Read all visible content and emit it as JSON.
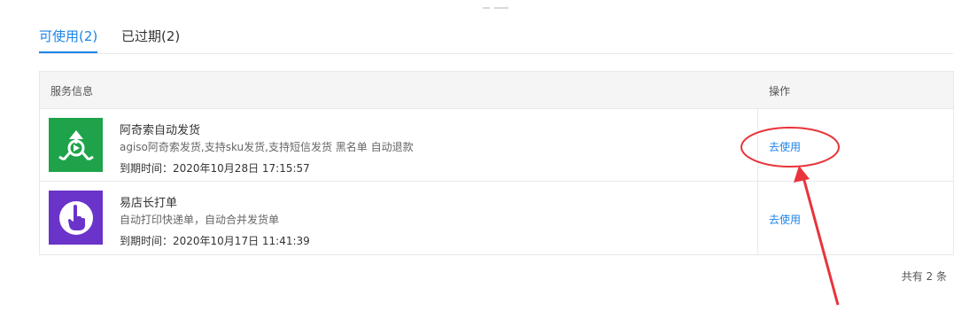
{
  "tabs": [
    {
      "label": "可使用(2)",
      "active": true
    },
    {
      "label": "已过期(2)",
      "active": false
    }
  ],
  "table": {
    "headers": {
      "info": "服务信息",
      "action": "操作"
    },
    "rows": [
      {
        "name": "阿奇索自动发货",
        "desc": "agiso阿奇索发货,支持sku发货,支持短信发货 黑名单 自动退款",
        "expiry": "到期时间：2020年10月28日 17:15:57",
        "action": "去使用",
        "logo_color": "#1ea34a",
        "icon": "agiso-logo-icon"
      },
      {
        "name": "易店长打单",
        "desc": "自动打印快递单，自动合并发货单",
        "expiry": "到期时间：2020年10月17日 11:41:39",
        "action": "去使用",
        "logo_color": "#6a33c9",
        "icon": "pointing-hand-icon"
      }
    ]
  },
  "total": "共有 2 条",
  "colors": {
    "accent": "#1c85e8",
    "annotation": "#e8343a"
  }
}
